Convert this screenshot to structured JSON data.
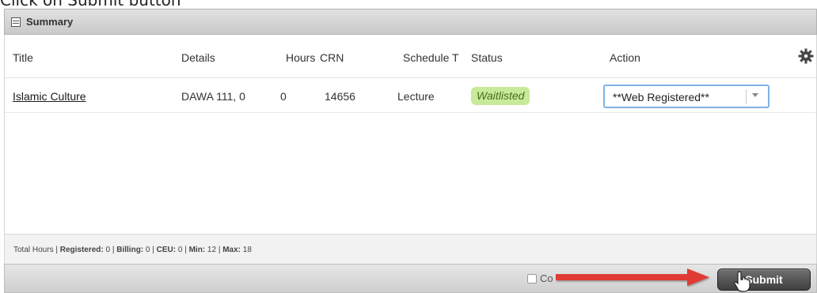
{
  "caption": "Click on Submit button",
  "panel": {
    "title": "Summary"
  },
  "columns": [
    "Title",
    "Details",
    "Hours",
    "CRN",
    "Schedule T",
    "Status",
    "Action"
  ],
  "row": {
    "title": "Islamic Culture",
    "details": "DAWA 111, 0",
    "hours": "0",
    "crn": "14656",
    "schedule": "Lecture",
    "status": "Waitlisted",
    "action": "**Web Registered**"
  },
  "totals": {
    "prefix": "Total Hours | ",
    "registered_label": "Registered:",
    "registered": " 0 | ",
    "billing_label": "Billing:",
    "billing": " 0 | ",
    "ceu_label": "CEU:",
    "ceu": " 0 | ",
    "min_label": "Min:",
    "min": " 12 | ",
    "max_label": "Max:",
    "max": " 18"
  },
  "footer": {
    "conditional_label": "Co",
    "submit_label": "Submit"
  },
  "icons": {
    "summary": "summary-icon",
    "gear": "gear-icon",
    "dropdown": "chevron-down-icon",
    "cursor": "hand-cursor-icon",
    "arrow": "red-arrow-annotation"
  },
  "colors": {
    "status_bg": "#c7ea99",
    "select_border": "#7fb2e6",
    "arrow": "#e03a35",
    "submit_bg": "#4a4a4a"
  }
}
